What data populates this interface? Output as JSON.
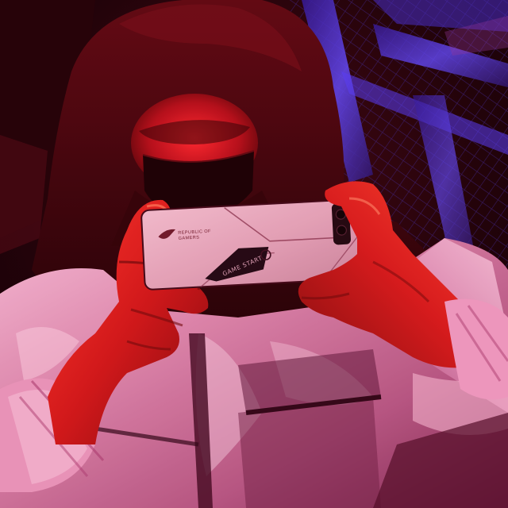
{
  "image": {
    "subject": "hooded person holding smartphone in landscape",
    "palette": {
      "background_dark": "#0b0306",
      "neon_blue": "#4a3cff",
      "neon_red": "#e0142a",
      "jacket_pink": "#e9a9c9",
      "phone_pink": "#e6b4c8"
    }
  },
  "phone": {
    "brand_line_1": "REPUBLIC OF",
    "brand_line_2": "GAMERS",
    "game_start_label": "GAME START"
  }
}
